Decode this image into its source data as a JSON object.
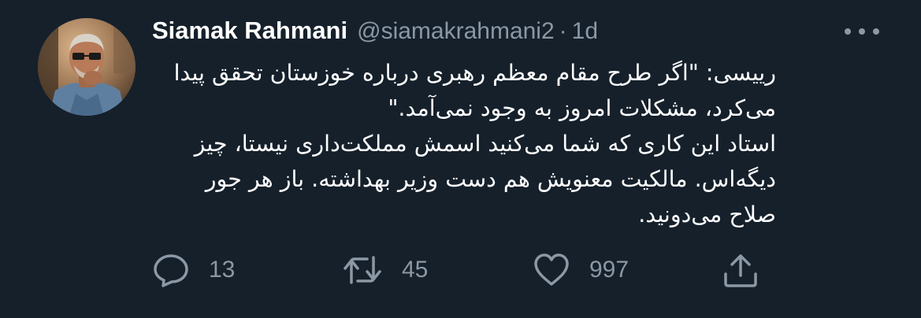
{
  "author": {
    "display_name": "Siamak Rahmani",
    "handle": "@siamakrahmani2",
    "separator": "·",
    "time": "1d"
  },
  "tweet": {
    "lines": [
      "رییسی: \"اگر طرح مقام معظم رهبری درباره خوزستان تحقق پیدا",
      "می‌کرد، مشکلات امروز به وجود نمی‌آمد.\"",
      "استاد این کاری که شما می‌کنید اسمش مملکت‌داری نیستا، چیز",
      "دیگه‌اس. مالکیت معنویش هم دست وزیر بهداشته. باز هر جور",
      "صلاح می‌دونید."
    ]
  },
  "actions": {
    "replies": "13",
    "retweets": "45",
    "likes": "997"
  },
  "icons": {
    "more": "more-horizontal-icon",
    "reply": "speech-bubble-icon",
    "retweet": "retweet-arrows-icon",
    "like": "heart-icon",
    "share": "share-upload-icon"
  },
  "colors": {
    "background": "#15202b",
    "text": "#ffffff",
    "secondary": "#8b98a5"
  }
}
